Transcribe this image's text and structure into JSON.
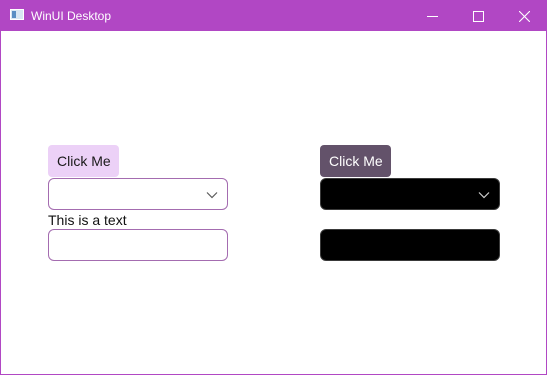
{
  "window": {
    "title": "WinUI Desktop",
    "accent_color": "#b147c4",
    "icons": {
      "app": "app-window-icon",
      "minimize": "minimize-icon",
      "maximize": "maximize-icon",
      "close": "close-icon"
    }
  },
  "light_panel": {
    "button_label": "Click Me",
    "button_color": "#ecd1f7",
    "combobox_value": "",
    "text_label": "This is a text",
    "textbox_value": "",
    "textbox_placeholder": ""
  },
  "dark_panel": {
    "button_label": "Click Me",
    "button_color": "#63526a",
    "combobox_value": "",
    "textbox_value": "",
    "textbox_placeholder": ""
  }
}
